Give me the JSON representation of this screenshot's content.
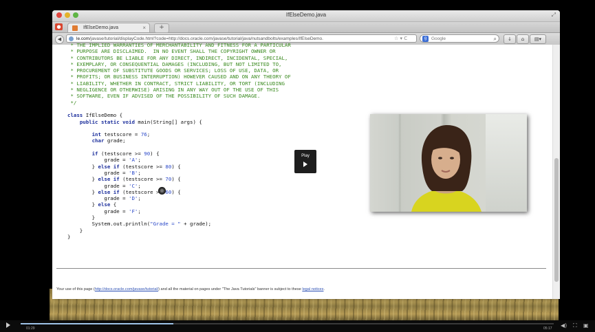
{
  "window": {
    "title": "IfElseDemo.java"
  },
  "tab": {
    "label": "IfElseDemo.java",
    "close": "×",
    "new_tab": "+"
  },
  "nav": {
    "url_host": "le.com",
    "url_rest": "/javase/tutorial/displayCode.html?code=http://docs.oracle.com/javase/tutorial/java/nutsandbolts/examples/IfElseDemo.",
    "url_controls": "☆ ▾ C",
    "search_placeholder": "Google",
    "search_engine_letter": "g"
  },
  "code": {
    "comment_lines": [
      " * THE IMPLIED WARRANTIES OF MERCHANTABILITY AND FITNESS FOR A PARTICULAR",
      " * PURPOSE ARE DISCLAIMED.  IN NO EVENT SHALL THE COPYRIGHT OWNER OR",
      " * CONTRIBUTORS BE LIABLE FOR ANY DIRECT, INDIRECT, INCIDENTAL, SPECIAL,",
      " * EXEMPLARY, OR CONSEQUENTIAL DAMAGES (INCLUDING, BUT NOT LIMITED TO,",
      " * PROCUREMENT OF SUBSTITUTE GOODS OR SERVICES; LOSS OF USE, DATA, OR",
      " * PROFITS; OR BUSINESS INTERRUPTION) HOWEVER CAUSED AND ON ANY THEORY OF",
      " * LIABILITY, WHETHER IN CONTRACT, STRICT LIABILITY, OR TORT (INCLUDING",
      " * NEGLIGENCE OR OTHERWISE) ARISING IN ANY WAY OUT OF THE USE OF THIS",
      " * SOFTWARE, EVEN IF ADVISED OF THE POSSIBILITY OF SUCH DAMAGE.",
      " */"
    ],
    "class_name": "IfElseDemo",
    "method_sig": "main(String[] args) {",
    "score_value": "76",
    "thresholds": [
      "90",
      "80",
      "70",
      "60"
    ],
    "grades": [
      "'A'",
      "'B'",
      "'C'",
      "'D'",
      "'F'"
    ],
    "println_str": "\"Grade = \"",
    "println_rest": " + grade);"
  },
  "footer": {
    "prefix": "Your use of this page (",
    "link1": "http://docs.oracle.com/javase/tutorial/",
    "middle": ") and all the material on pages under \"The Java Tutorials\" banner is subject to these ",
    "link2": "legal notices",
    "suffix": "."
  },
  "overlay": {
    "play_label": "Play"
  },
  "player": {
    "current_time": "01:29",
    "total_time": "05:17",
    "progress": 0.2865
  }
}
